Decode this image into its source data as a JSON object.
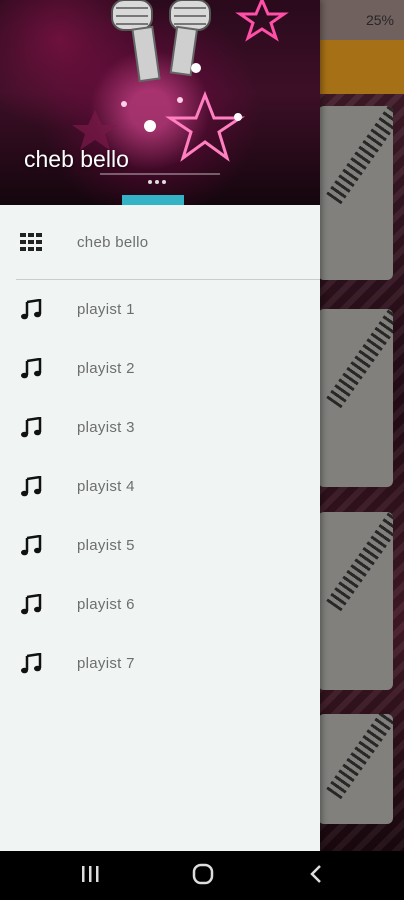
{
  "status_bar": {
    "battery": "25%"
  },
  "drawer": {
    "header_title": "cheb bello",
    "items": [
      {
        "label": "cheb bello",
        "icon": "grid-icon"
      },
      {
        "label": "playist 1",
        "icon": "music-note-icon"
      },
      {
        "label": "playist 2",
        "icon": "music-note-icon"
      },
      {
        "label": "playist 3",
        "icon": "music-note-icon"
      },
      {
        "label": "playist 4",
        "icon": "music-note-icon"
      },
      {
        "label": "playist 5",
        "icon": "music-note-icon"
      },
      {
        "label": "playist 6",
        "icon": "music-note-icon"
      },
      {
        "label": "playist 7",
        "icon": "music-note-icon"
      }
    ]
  },
  "nav_bar": {
    "buttons": [
      "recent-apps-icon",
      "home-icon",
      "back-icon"
    ]
  },
  "colors": {
    "drawer_bg": "#f0f5f4",
    "toolbar": "#b57a18",
    "label_text": "#6e6e6e",
    "header_accent": "#34b3c7"
  }
}
